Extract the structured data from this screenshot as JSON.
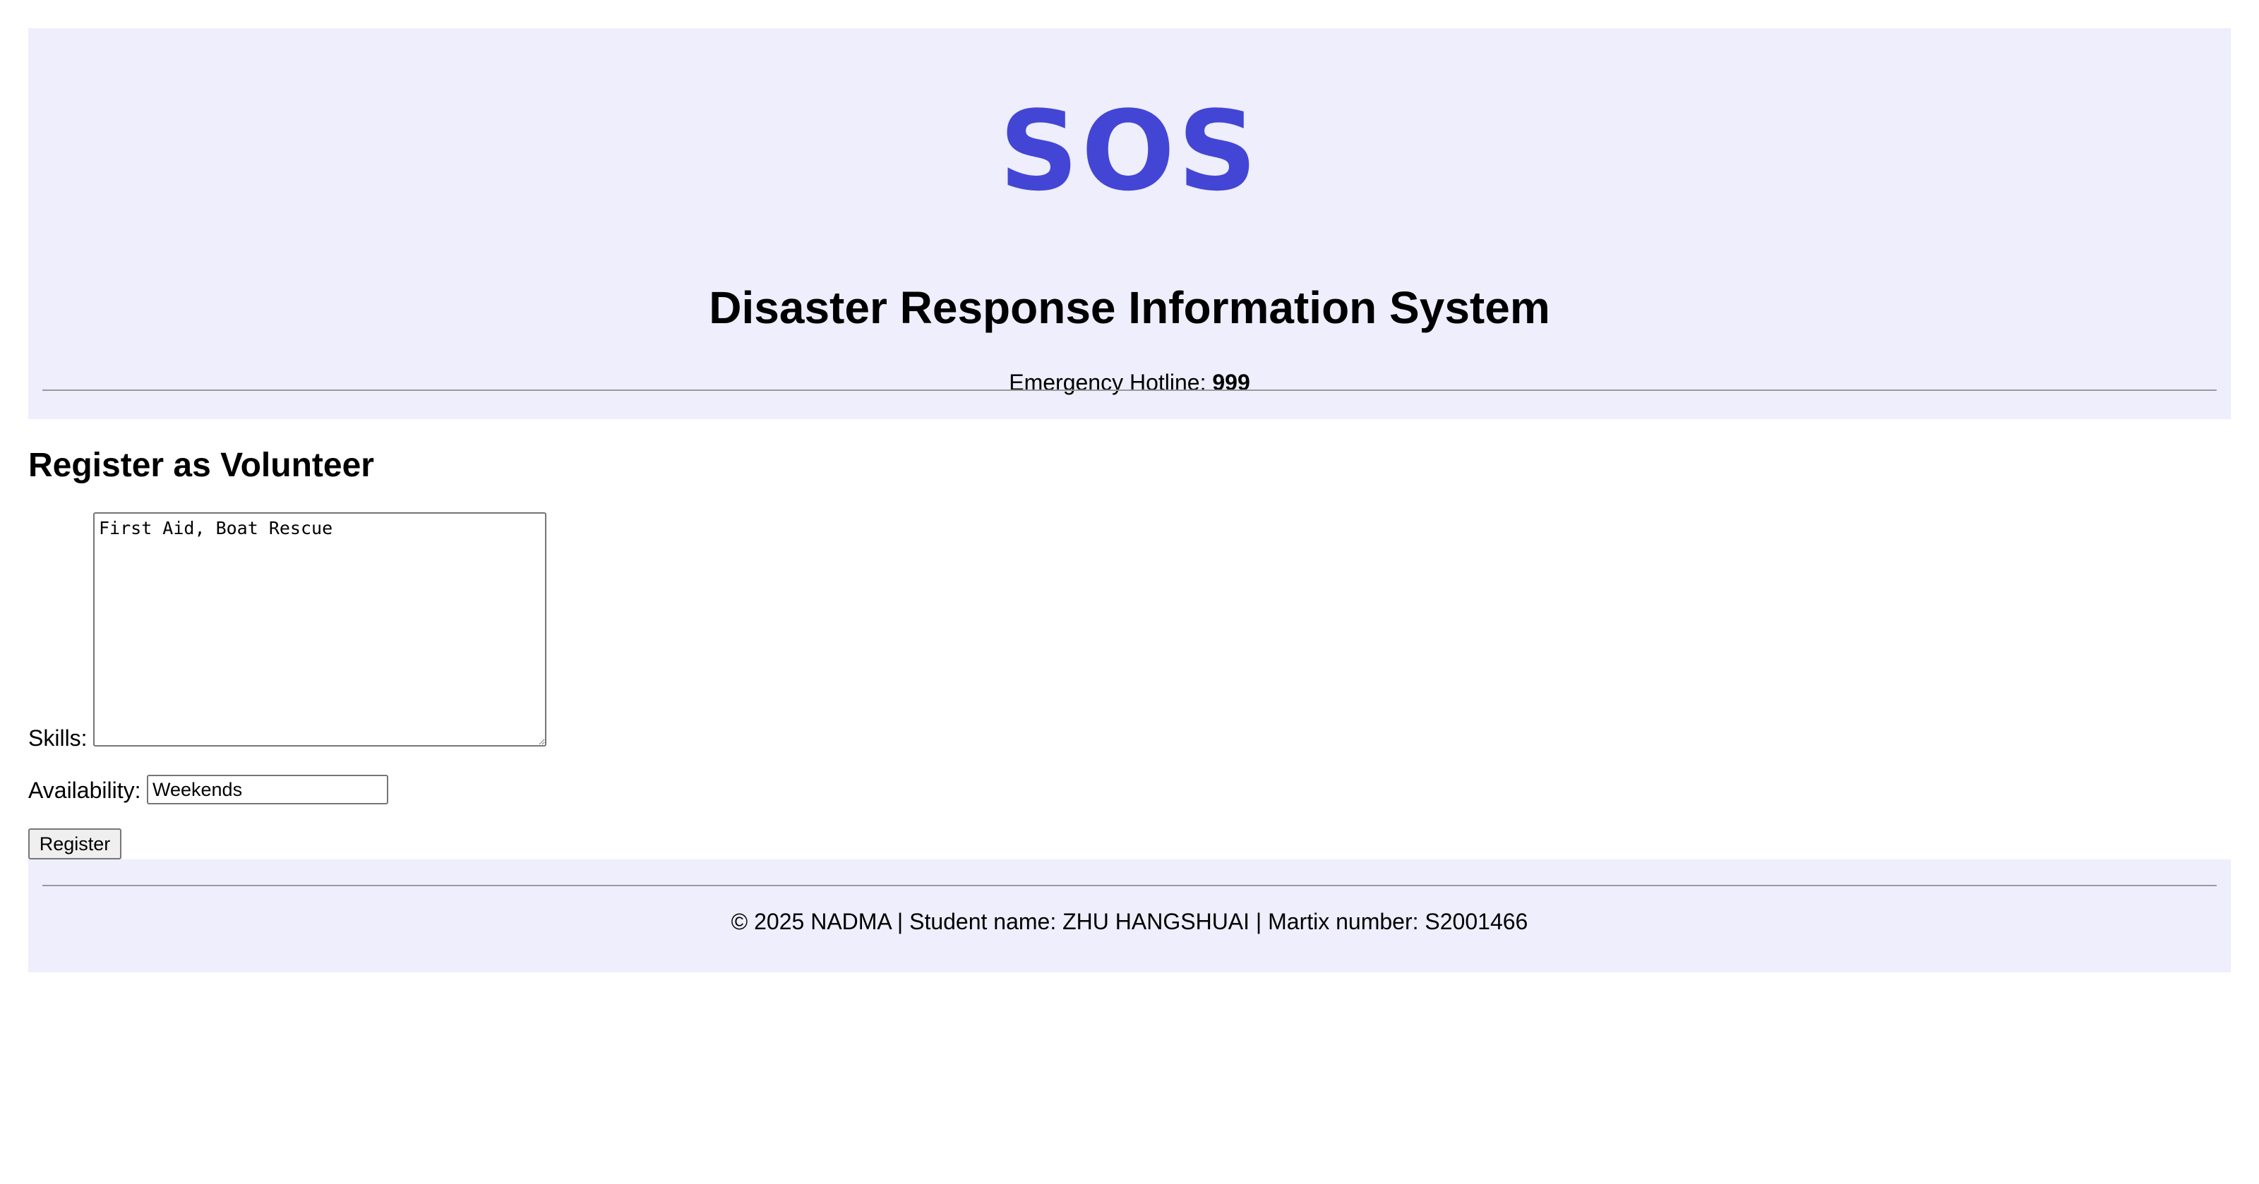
{
  "header": {
    "logo_text": "SOS",
    "site_title": "Disaster Response Information System",
    "hotline_label": "Emergency Hotline: ",
    "hotline_number": "999"
  },
  "form": {
    "title": "Register as Volunteer",
    "skills_label": "Skills:",
    "skills_value": "First Aid, Boat Rescue",
    "availability_label": "Availability:",
    "availability_value": "Weekends",
    "submit_label": "Register"
  },
  "footer": {
    "text": "© 2025 NADMA | Student name: ZHU HANGSHUAI | Martix number: S2001466"
  },
  "colors": {
    "accent": "#4346d4",
    "panel_background": "#eeeefc"
  }
}
